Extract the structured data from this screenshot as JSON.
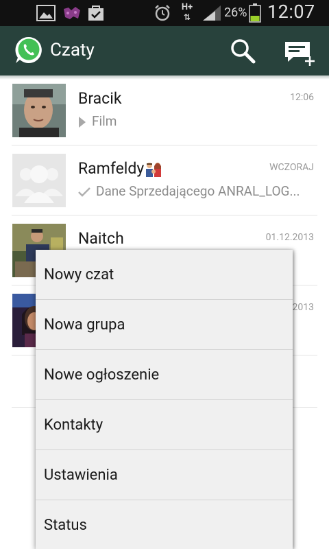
{
  "status_bar": {
    "network": "H+",
    "battery_percent": "26%",
    "time": "12:07",
    "icons": [
      "gallery-icon",
      "gamepad-icon",
      "shopping-bag-icon",
      "alarm-icon",
      "signal-icon",
      "battery-icon"
    ]
  },
  "action_bar": {
    "title": "Czaty",
    "icons": [
      "whatsapp-logo-icon",
      "search-icon",
      "new-chat-icon"
    ],
    "brand_color": "#28423c"
  },
  "chats": [
    {
      "name": "Bracik",
      "time": "12:06",
      "preview": "Film",
      "preview_icon": "play-icon"
    },
    {
      "name": "Ramfeldy",
      "name_emoji": "family-emoji-icon",
      "time": "WCZORAJ",
      "preview": "Dane Sprzedającego ANRAL_LOG...",
      "preview_icon": "check-icon"
    },
    {
      "name": "Naitch",
      "time": "01.12.2013"
    },
    {
      "time": "2013"
    }
  ],
  "menu": {
    "items": [
      "Nowy czat",
      "Nowa grupa",
      "Nowe ogłoszenie",
      "Kontakty",
      "Ustawienia",
      "Status"
    ]
  }
}
